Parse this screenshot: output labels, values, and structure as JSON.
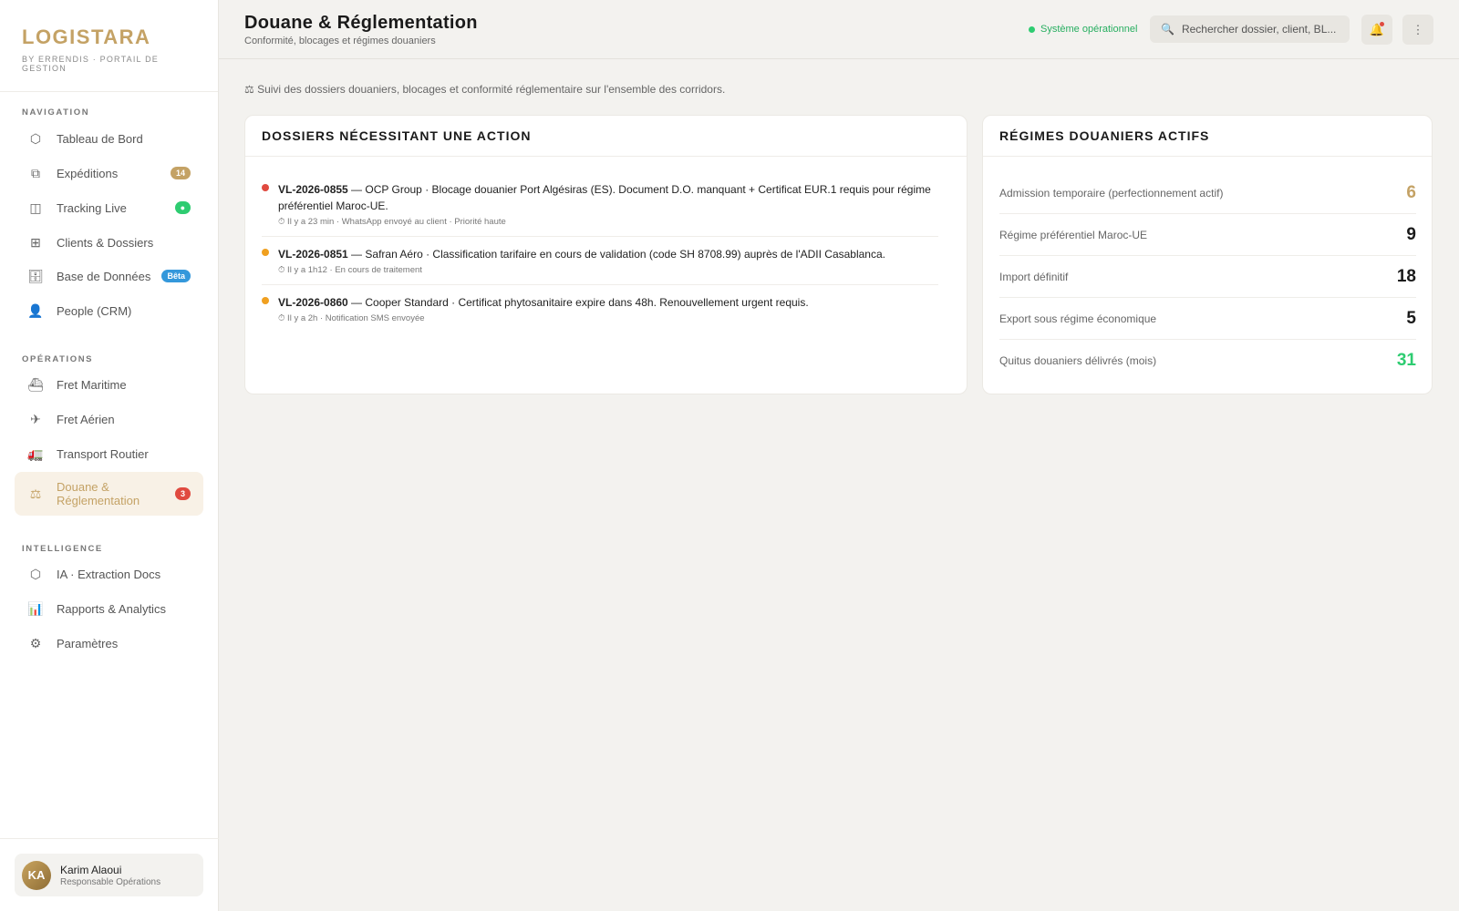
{
  "brand": {
    "name": "LOGISTARA",
    "subtitle": "BY ERRENDIS · PORTAIL DE GESTION"
  },
  "sidebar": {
    "sections": [
      {
        "title": "NAVIGATION"
      },
      {
        "title": "OPÉRATIONS"
      },
      {
        "title": "INTELLIGENCE"
      }
    ],
    "items": [
      {
        "label": "Tableau de Bord",
        "icon": "dashboard-icon"
      },
      {
        "label": "Expéditions",
        "icon": "shipments-icon",
        "badge": "14"
      },
      {
        "label": "Tracking Live",
        "icon": "tracking-icon",
        "badge": "●"
      },
      {
        "label": "Clients & Dossiers",
        "icon": "clients-icon"
      },
      {
        "label": "Base de Données",
        "icon": "database-icon",
        "badge": "Bêta"
      },
      {
        "label": "People (CRM)",
        "icon": "people-icon"
      },
      {
        "label": "Fret Maritime",
        "icon": "ship-icon"
      },
      {
        "label": "Fret Aérien",
        "icon": "plane-icon"
      },
      {
        "label": "Transport Routier",
        "icon": "truck-icon"
      },
      {
        "label": "Douane & Réglementation",
        "icon": "scales-icon",
        "badge": "3"
      },
      {
        "label": "IA · Extraction Docs",
        "icon": "ai-icon"
      },
      {
        "label": "Rapports & Analytics",
        "icon": "chart-icon"
      },
      {
        "label": "Paramètres",
        "icon": "gear-icon"
      }
    ]
  },
  "user": {
    "initials": "KA",
    "name": "Karim Alaoui",
    "role": "Responsable Opérations"
  },
  "header": {
    "title": "Douane & Réglementation",
    "subtitle": "Conformité, blocages et régimes douaniers",
    "status": "Système opérationnel",
    "search_placeholder": "Rechercher dossier, client, BL..."
  },
  "intro": "⚖ Suivi des dossiers douaniers, blocages et conformité réglementaire sur l'ensemble des corridors.",
  "actions_card": {
    "title": "DOSSIERS NÉCESSITANT UNE ACTION",
    "items": [
      {
        "id": "VL-2026-0855",
        "text": " — OCP Group · Blocage douanier Port Algésiras (ES). Document D.O. manquant + Certificat EUR.1 requis pour régime préférentiel Maroc-UE.",
        "meta": "⏱ Il y a 23 min · WhatsApp envoyé au client · Priorité haute",
        "priority_color": "#e04a3f"
      },
      {
        "id": "VL-2026-0851",
        "text": " — Safran Aéro · Classification tarifaire en cours de validation (code SH 8708.99) auprès de l'ADII Casablanca.",
        "meta": "⏱ Il y a 1h12 · En cours de traitement",
        "priority_color": "#f0a020"
      },
      {
        "id": "VL-2026-0860",
        "text": " — Cooper Standard · Certificat phytosanitaire expire dans 48h. Renouvellement urgent requis.",
        "meta": "⏱ Il y a 2h · Notification SMS envoyée",
        "priority_color": "#f0a020"
      }
    ]
  },
  "regimes_card": {
    "title": "RÉGIMES DOUANIERS ACTIFS",
    "rows": [
      {
        "label": "Admission temporaire (perfectionnement actif)",
        "value": "6",
        "color": "#c4a265"
      },
      {
        "label": "Régime préférentiel Maroc-UE",
        "value": "9",
        "color": "#1a1a1a"
      },
      {
        "label": "Import définitif",
        "value": "18",
        "color": "#1a1a1a"
      },
      {
        "label": "Export sous régime économique",
        "value": "5",
        "color": "#1a1a1a"
      },
      {
        "label": "Quitus douaniers délivrés (mois)",
        "value": "31",
        "color": "#2ecc71"
      }
    ]
  }
}
